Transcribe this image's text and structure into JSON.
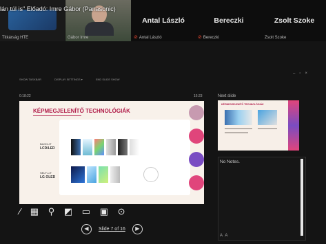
{
  "header": {
    "speaker_title": "lán túl is\" Előadó: Imre Gábor (Panasonic)"
  },
  "participants": [
    {
      "name": "Titkárság HTE"
    },
    {
      "name": "Gábor Imre"
    },
    {
      "name": "Antal László",
      "display": "Antal László"
    },
    {
      "name": "Bereczki",
      "display": "Bereczki"
    },
    {
      "name": "Zsolt Szoke",
      "display": "Zsolt Szoke"
    }
  ],
  "presenter": {
    "toolbar": {
      "show_taskbar": "SHOW TASKBAR",
      "display_settings": "DISPLAY SETTINGS ▾",
      "end_slide_show": "END SLIDE SHOW"
    },
    "timer": "0:18:22",
    "clock": "16:23",
    "next_slide_label": "Next slide",
    "notes_text": "No Notes.",
    "slide_indicator": "Slide 7 of 16"
  },
  "slide": {
    "title": "KÉPMEGJELENÍTŐ TECHNOLÓGIÁK",
    "row1_sub": "BACKLIT",
    "row1_tech": "LCD/LED",
    "row2_sub": "SELF-LIT",
    "row2_tech": "LG OLED"
  },
  "next_slide": {
    "title": "KÉPMEGJELENÍTŐ TECHNOLÓGIÁK"
  },
  "colors": {
    "accent": "#b01b48",
    "deco_pink": "#e0457b",
    "deco_purple": "#7a4cc2"
  }
}
